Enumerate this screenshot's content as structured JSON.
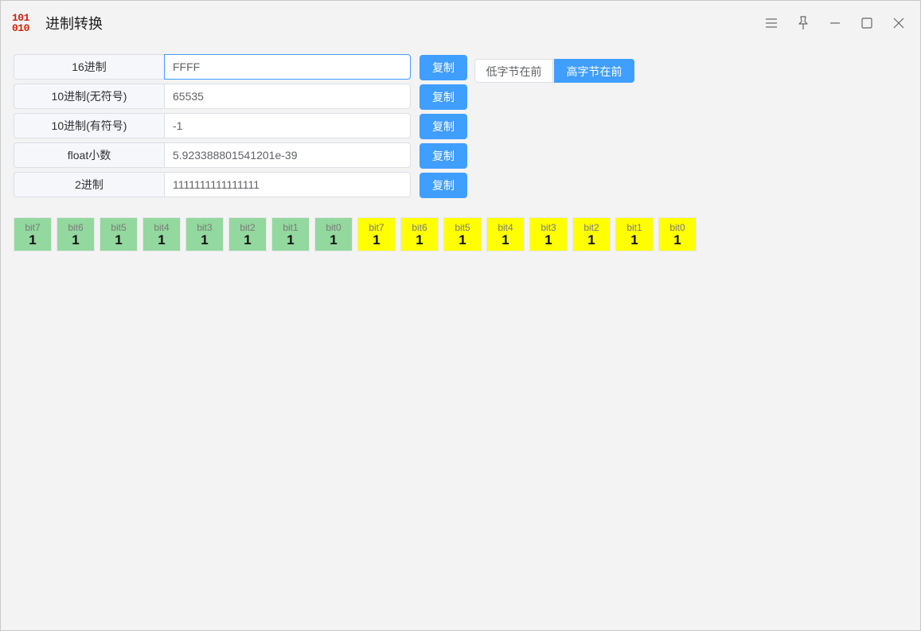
{
  "app": {
    "title": "进制转换",
    "logo_text_top": "101",
    "logo_text_bottom": "010",
    "logo_color": "#d81e06"
  },
  "window_controls": [
    "menu-icon",
    "pin-icon",
    "minimize-icon",
    "maximize-icon",
    "close-icon"
  ],
  "rows": [
    {
      "label": "16进制",
      "value": "FFFF"
    },
    {
      "label": "10进制(无符号)",
      "value": "65535"
    },
    {
      "label": "10进制(有符号)",
      "value": "-1"
    },
    {
      "label": "float小数",
      "value": "5.923388801541201e-39"
    },
    {
      "label": "2进制",
      "value": "1111111111111111"
    }
  ],
  "copy_label": "复制",
  "byte_order": {
    "little_endian": "低字节在前",
    "big_endian": "高字节在前",
    "selected": "big_endian"
  },
  "colors": {
    "accent": "#409eff",
    "high_byte": "#93d89e",
    "low_byte": "#ffff00"
  },
  "bits": {
    "high_byte": [
      {
        "name": "bit7",
        "value": "1"
      },
      {
        "name": "bit6",
        "value": "1"
      },
      {
        "name": "bit5",
        "value": "1"
      },
      {
        "name": "bit4",
        "value": "1"
      },
      {
        "name": "bit3",
        "value": "1"
      },
      {
        "name": "bit2",
        "value": "1"
      },
      {
        "name": "bit1",
        "value": "1"
      },
      {
        "name": "bit0",
        "value": "1"
      }
    ],
    "low_byte": [
      {
        "name": "bit7",
        "value": "1"
      },
      {
        "name": "bit6",
        "value": "1"
      },
      {
        "name": "bit5",
        "value": "1"
      },
      {
        "name": "bit4",
        "value": "1"
      },
      {
        "name": "bit3",
        "value": "1"
      },
      {
        "name": "bit2",
        "value": "1"
      },
      {
        "name": "bit1",
        "value": "1"
      },
      {
        "name": "bit0",
        "value": "1"
      }
    ]
  }
}
